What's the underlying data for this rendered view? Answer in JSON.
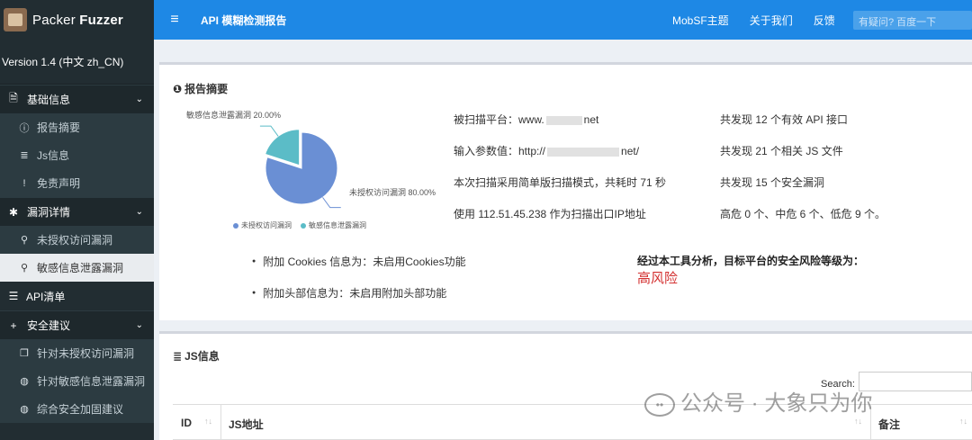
{
  "app": {
    "brand_prefix": "Packer",
    "brand_bold": "Fuzzer",
    "version": "Version 1.4 (中文 zh_CN)"
  },
  "sidebar": {
    "sections": [
      {
        "label": "基础信息",
        "icon": "file-icon",
        "items": [
          {
            "label": "报告摘要",
            "icon": "info-circle-icon"
          },
          {
            "label": "Js信息",
            "icon": "database-icon"
          },
          {
            "label": "免责声明",
            "icon": "exclamation-icon"
          }
        ]
      },
      {
        "label": "漏洞详情",
        "icon": "bug-icon",
        "items": [
          {
            "label": "未授权访问漏洞",
            "icon": "search-icon"
          },
          {
            "label": "敏感信息泄露漏洞",
            "icon": "search-icon"
          }
        ]
      }
    ],
    "api_list": "API清单",
    "security": {
      "label": "安全建议",
      "items": [
        {
          "label": "针对未授权访问漏洞",
          "icon": "copy-icon"
        },
        {
          "label": "针对敏感信息泄露漏洞",
          "icon": "globe-icon"
        },
        {
          "label": "综合安全加固建议",
          "icon": "globe-icon"
        }
      ]
    }
  },
  "topbar": {
    "title": "API 模糊检测报告",
    "links": [
      "MobSF主题",
      "关于我们",
      "反馈"
    ],
    "search_placeholder": "有疑问? 百度一下"
  },
  "summary": {
    "heading": "报告摘要",
    "platform": "被扫描平台：www.",
    "platform_tail": "net",
    "input": "输入参数值：http://",
    "input_tail": "net/",
    "mode": "本次扫描采用简单版扫描模式，共耗时 71 秒",
    "egress": "使用 112.51.45.238 作为扫描出口IP地址",
    "api_count": "共发现 12 个有效 API 接口",
    "js_count": "共发现 21 个相关 JS 文件",
    "vuln_count": "共发现 15 个安全漏洞",
    "levels": "高危 0 个、中危 6 个、低危 9 个。",
    "cookies": "附加 Cookies 信息为：未启用Cookies功能",
    "headers": "附加头部信息为：未启用附加头部功能",
    "risk_question": "经过本工具分析，目标平台的安全风险等级为：",
    "risk_value": "高风险",
    "risk_color": "#d32f2f"
  },
  "chart_data": {
    "type": "pie",
    "series": [
      {
        "name": "未授权访问漏洞",
        "value": 80.0,
        "color": "#6a8fd4"
      },
      {
        "name": "敏感信息泄露漏洞",
        "value": 20.0,
        "color": "#5bbcc7"
      }
    ],
    "labels": [
      "未授权访问漏洞 80.00%",
      "敏感信息泄露漏洞 20.00%"
    ],
    "legend_position": "bottom"
  },
  "js_info": {
    "heading": "JS信息",
    "search_label": "Search:",
    "columns": [
      "ID",
      "JS地址",
      "备注"
    ]
  },
  "watermark": "公众号 · 大象只为你"
}
